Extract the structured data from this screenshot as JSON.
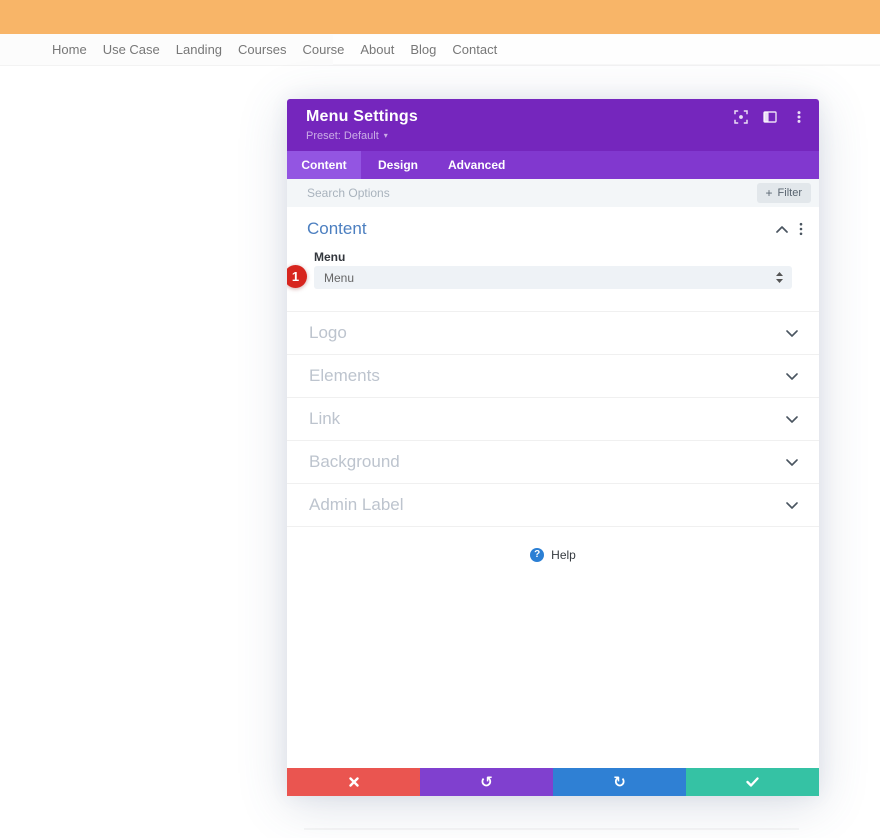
{
  "page": {
    "nav_items": [
      "Home",
      "Use Case",
      "Landing",
      "Courses",
      "Course",
      "About",
      "Blog",
      "Contact"
    ]
  },
  "modal": {
    "title": "Menu Settings",
    "preset": "Preset: Default",
    "tabs": [
      {
        "label": "Content",
        "active": true
      },
      {
        "label": "Design",
        "active": false
      },
      {
        "label": "Advanced",
        "active": false
      }
    ],
    "search_placeholder": "Search Options",
    "filter_label": "Filter",
    "section_title": "Content",
    "field_label": "Menu",
    "field_value": "Menu",
    "badge_count": "1",
    "sections": [
      {
        "label": "Logo"
      },
      {
        "label": "Elements"
      },
      {
        "label": "Link"
      },
      {
        "label": "Background"
      },
      {
        "label": "Admin Label"
      }
    ],
    "help_label": "Help"
  },
  "icons": {
    "preset_caret": "▾",
    "filter_plus": "+",
    "help_question": "?",
    "undo": "↺",
    "redo": "↻"
  },
  "colors": {
    "topbar_orange": "#f8b568",
    "header_purple": "#7526bd",
    "tabbar_purple": "#8138cf",
    "active_tab_purple": "#9355e2",
    "section_title_blue": "#4c7fc0",
    "badge_red": "#d7251e",
    "help_blue": "#2b7fd4",
    "action_close_red": "#ea5550",
    "action_undo_purple": "#8040cf",
    "action_redo_blue": "#2f80d4",
    "action_save_teal": "#35c2a4"
  }
}
